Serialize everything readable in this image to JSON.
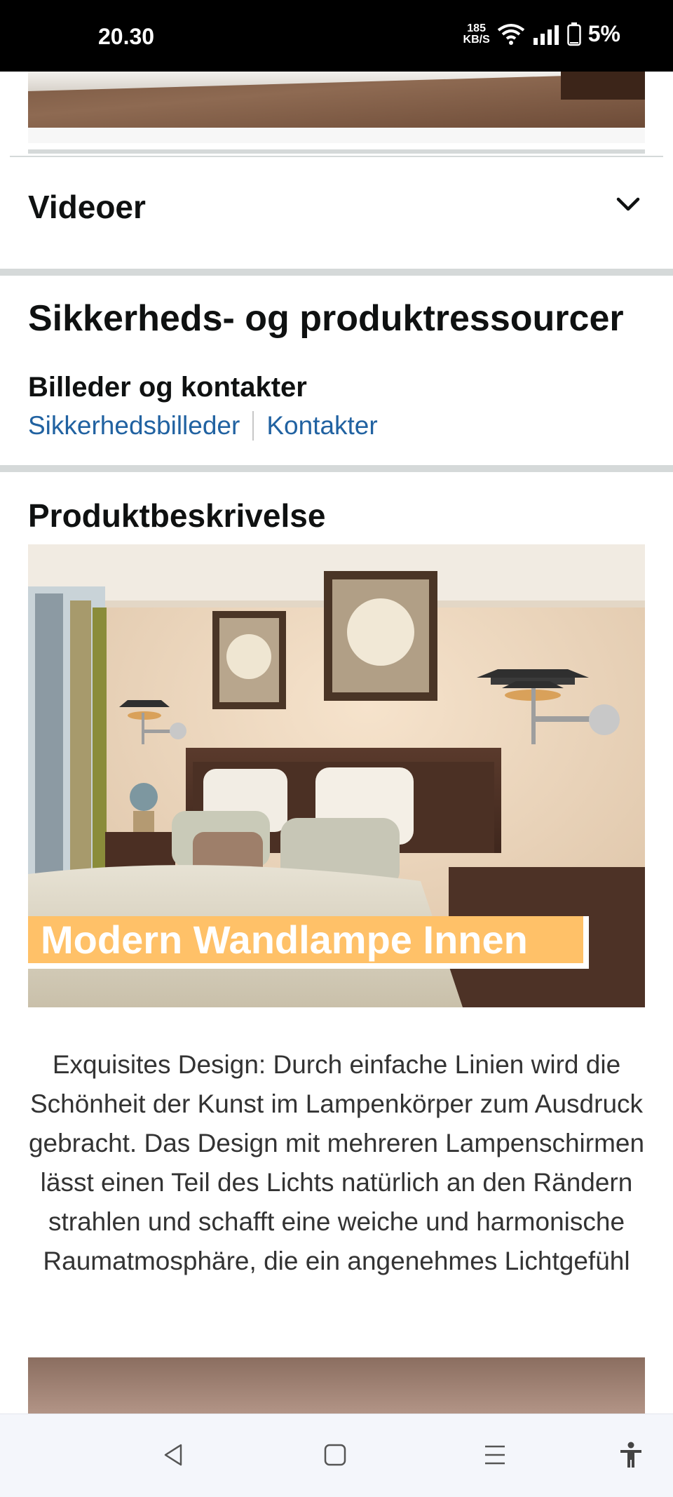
{
  "status_bar": {
    "time": "20.30",
    "net_speed_value": "185",
    "net_speed_unit": "KB/S",
    "battery": "5%"
  },
  "videos": {
    "title": "Videoer"
  },
  "safety": {
    "title": "Sikkerheds- og produktressourcer",
    "subtitle": "Billeder og kontakter",
    "links": [
      "Sikkerhedsbilleder",
      "Kontakter"
    ]
  },
  "product_description": {
    "title": "Produktbeskrivelse",
    "image_banner": "Modern Wandlampe Innen",
    "text": "Exquisites Design: Durch einfache Linien wird die Schönheit der Kunst im Lampenkörper zum Ausdruck gebracht. Das Design mit mehreren Lampenschirmen lässt einen Teil des Lichts natürlich an den Rändern strahlen und schafft eine weiche und harmonische Raumatmosphäre, die ein angenehmes Lichtgefühl"
  },
  "colors": {
    "link": "#2162a1",
    "banner": "#ffc168",
    "separator": "#d5d9d9"
  },
  "icons": {
    "videos_toggle": "chevron-down-icon",
    "nav": [
      "back-icon",
      "home-icon",
      "recents-icon",
      "accessibility-icon"
    ]
  }
}
